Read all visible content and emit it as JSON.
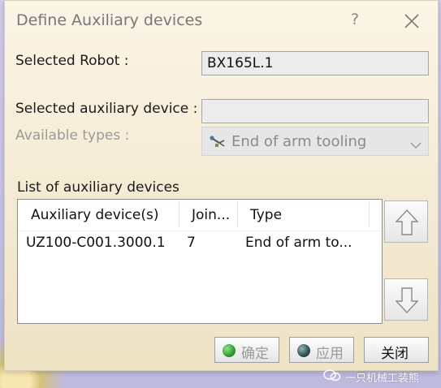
{
  "window": {
    "title": "Define Auxiliary devices",
    "help_label": "?"
  },
  "form": {
    "selected_robot_label": "Selected Robot :",
    "selected_robot_value": "BX165L.1",
    "selected_aux_label": "Selected auxiliary device :",
    "selected_aux_value": "",
    "available_types_label": "Available types :",
    "available_types_value": "End of arm tooling",
    "available_types_icon": "tooling-icon"
  },
  "list": {
    "title": "List of auxiliary devices",
    "columns": [
      "Auxiliary device(s)",
      "Join...",
      "Type"
    ],
    "rows": [
      [
        "UZ100-C001.3000.1",
        "7",
        "End of arm to..."
      ]
    ]
  },
  "buttons": {
    "ok_label": "确定",
    "apply_label": "应用",
    "close_label": "关闭",
    "ok_dot_color": "#2f9a2f",
    "apply_dot_color": "#2f4f4f"
  },
  "watermark": {
    "text": "一只机械工装熊",
    "icon": "wechat-icon"
  },
  "colors": {
    "dialog_bg": "#f4ead3",
    "desktop_bg": "#c9c6e6"
  }
}
